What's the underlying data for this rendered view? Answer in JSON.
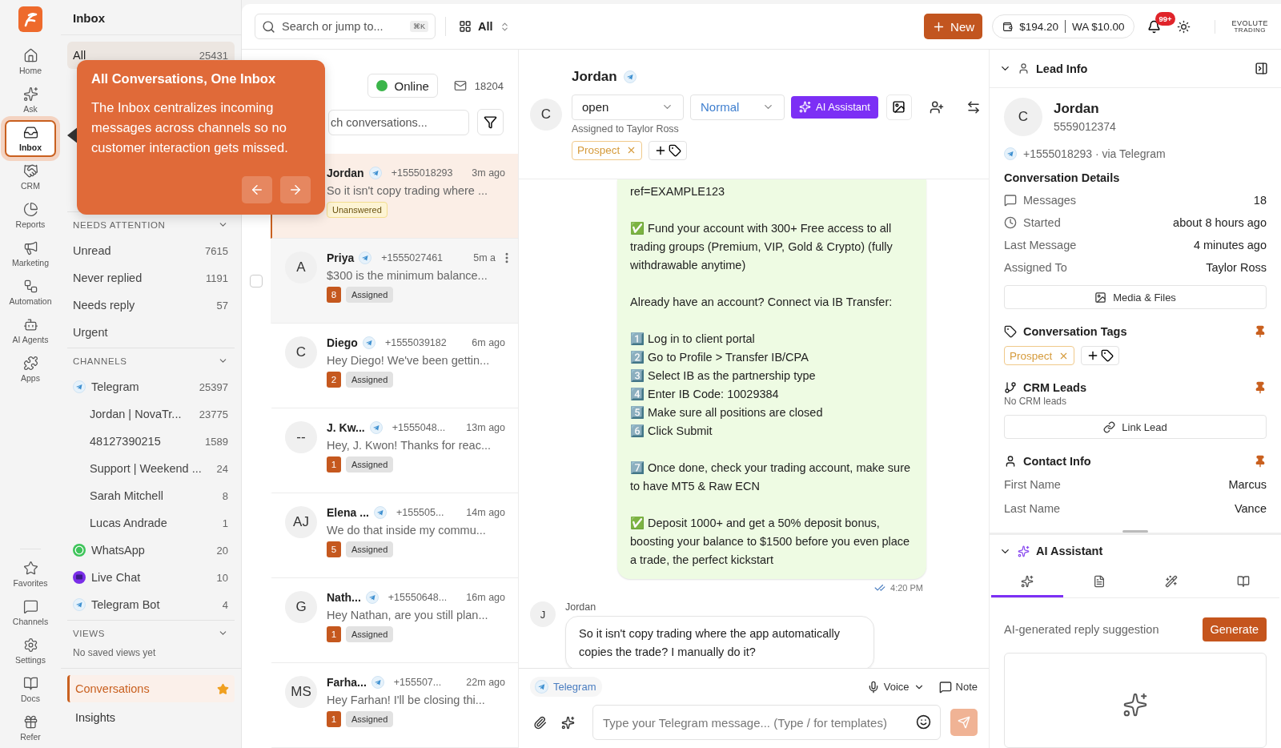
{
  "rail": {
    "top": [
      {
        "label": "Home",
        "selected": false
      },
      {
        "label": "Ask",
        "selected": false
      },
      {
        "label": "Inbox",
        "selected": true
      },
      {
        "label": "CRM",
        "selected": false
      },
      {
        "label": "Reports",
        "selected": false
      },
      {
        "label": "Marketing",
        "selected": false
      },
      {
        "label": "Automation",
        "selected": false
      },
      {
        "label": "AI Agents",
        "selected": false
      },
      {
        "label": "Apps",
        "selected": false
      }
    ],
    "bottom": [
      {
        "label": "Favorites",
        "selected": false
      },
      {
        "label": "Channels",
        "selected": false
      },
      {
        "label": "Settings",
        "selected": false
      },
      {
        "label": "Docs",
        "selected": false
      },
      {
        "label": "Refer",
        "selected": false
      }
    ]
  },
  "sidebar": {
    "title": "Inbox",
    "views": [
      {
        "label": "All",
        "count": "25431",
        "selected": true
      }
    ],
    "needs_attention": {
      "title": "NEEDS ATTENTION",
      "items": [
        {
          "label": "Unread",
          "count": "7615"
        },
        {
          "label": "Never replied",
          "count": "1191"
        },
        {
          "label": "Needs reply",
          "count": "57"
        },
        {
          "label": "Urgent"
        }
      ]
    },
    "channels": {
      "title": "CHANNELS",
      "items": [
        {
          "label": "Telegram",
          "count": "25397",
          "kind": "telegram",
          "children": [
            {
              "label": "Jordan | NovaTr...",
              "count": "23775"
            },
            {
              "label": "48127390215",
              "count": "1589"
            },
            {
              "label": "Support | Weekend ...",
              "count": "24"
            },
            {
              "label": "Sarah Mitchell",
              "count": "8"
            },
            {
              "label": "Lucas Andrade",
              "count": "1"
            }
          ]
        },
        {
          "label": "WhatsApp",
          "count": "20",
          "kind": "whatsapp"
        },
        {
          "label": "Live Chat",
          "count": "10",
          "kind": "livechat"
        },
        {
          "label": "Telegram Bot",
          "count": "4",
          "kind": "telegram"
        }
      ]
    },
    "saved_views": {
      "title": "VIEWS",
      "empty": "No saved views yet"
    },
    "pages": [
      {
        "label": "Conversations",
        "selected": true,
        "starred": true
      },
      {
        "label": "Insights",
        "selected": false,
        "starred": false
      }
    ]
  },
  "tooltip": {
    "title": "All Conversations, One Inbox",
    "body": "The Inbox centralizes incoming messages across channels so no customer interaction gets missed."
  },
  "topbar": {
    "search": {
      "placeholder": "Search or jump to...",
      "shortcut": "⌘K"
    },
    "scope": "All",
    "new_button": "New",
    "balance": "$194.20",
    "wa_balance": "WA $10.00",
    "notifications": "99+",
    "logo": [
      "EVOLUTE",
      "TRADING"
    ]
  },
  "conversation_list": {
    "status": "Online",
    "online": true,
    "mail_count": "18204",
    "search": {
      "placeholder": "ch conversations..."
    },
    "items": [
      {
        "name": "Jordan",
        "phone": "+1555018293",
        "time": "3m ago",
        "preview": "So it isn't copy trading where ...",
        "tag": {
          "label": "Unanswered",
          "kind": "unanswered"
        },
        "selected": true,
        "hovered": false
      },
      {
        "avatar": "A",
        "name": "Priya",
        "phone": "+1555027461",
        "time": "5m a",
        "preview": "$300 is the minimum balance...",
        "count": "8",
        "tag": {
          "label": "Assigned",
          "kind": "assigned"
        },
        "selected": false,
        "hovered": true,
        "checked": false
      },
      {
        "avatar": "C",
        "name": "Diego",
        "phone": "+1555039182",
        "time": "6m ago",
        "preview": "Hey Diego! We've been gettin...",
        "count": "2",
        "tag": {
          "label": "Assigned",
          "kind": "assigned"
        },
        "selected": false,
        "hovered": false
      },
      {
        "avatar": "--",
        "name": "J. Kw...",
        "phone": "+1555048...",
        "time": "13m ago",
        "preview": "Hey, J. Kwon! Thanks for reac...",
        "count": "1",
        "tag": {
          "label": "Assigned",
          "kind": "assigned"
        },
        "selected": false,
        "hovered": false
      },
      {
        "avatar": "AJ",
        "name": "Elena ...",
        "phone": "+155505...",
        "time": "14m ago",
        "preview": "We do that inside my commu...",
        "count": "5",
        "tag": {
          "label": "Assigned",
          "kind": "assigned"
        },
        "selected": false,
        "hovered": false
      },
      {
        "avatar": "G",
        "name": "Nath...",
        "phone": "+15550648...",
        "time": "16m ago",
        "preview": "Hey Nathan, are you still plan...",
        "count": "1",
        "tag": {
          "label": "Assigned",
          "kind": "assigned"
        },
        "selected": false,
        "hovered": false
      },
      {
        "avatar": "MS",
        "name": "Farha...",
        "phone": "+155507...",
        "time": "22m ago",
        "preview": "Hey Farhan! I'll be closing thi...",
        "count": "1",
        "tag": {
          "label": "Assigned",
          "kind": "assigned"
        },
        "selected": false,
        "hovered": false
      }
    ]
  },
  "chat": {
    "avatar": "C",
    "name": "Jordan",
    "status": "open",
    "priority": "Normal",
    "assigned": "Assigned to Taylor Ross",
    "tags": [
      "Prospect"
    ],
    "ai_button": "AI Assistant",
    "messages": [
      {
        "kind": "outgoing",
        "text": "ref=EXAMPLE123\n\n✅ Fund your account with 300+ Free access to all trading groups (Premium, VIP, Gold & Crypto) (fully withdrawable anytime)\n\nAlready have an account? Connect via IB Transfer:\n\n1️⃣ Log in to client portal\n2️⃣ Go to Profile > Transfer IB/CPA\n3️⃣ Select IB as the partnership type\n4️⃣ Enter IB Code: 10029384\n5️⃣ Make sure all positions are closed\n6️⃣ Click Submit\n\n7️⃣ Once done, check your trading account, make sure to have MT5 & Raw ECN\n\n✅ Deposit 1000+ and get a 50% deposit bonus, boosting your balance to $1500 before you even place a trade, the perfect kickstart",
        "time": "4:20 PM",
        "read": true
      },
      {
        "kind": "incoming",
        "avatar": "J",
        "sender": "Jordan",
        "text": "So it isn't copy trading where the app automatically copies the trade? I manually do it?"
      }
    ],
    "composer": {
      "channel": "Telegram",
      "voice": "Voice",
      "note": "Note",
      "placeholder": "Type your Telegram message... (Type / for templates)",
      "send_disabled": true
    }
  },
  "lead": {
    "title": "Lead Info",
    "avatar": "C",
    "name": "Jordan",
    "id": "5559012374",
    "contact": "+1555018293 · via Telegram",
    "details_title": "Conversation Details",
    "details": [
      {
        "label": "Messages",
        "value": "18"
      },
      {
        "label": "Started",
        "value": "about 8 hours ago"
      },
      {
        "label": "Last Message",
        "value": "4 minutes ago"
      },
      {
        "label": "Assigned To",
        "value": "Taylor Ross"
      }
    ],
    "media_button": "Media & Files",
    "tags_title": "Conversation Tags",
    "tags": [
      "Prospect"
    ],
    "crm_title": "CRM Leads",
    "crm_empty": "No CRM leads",
    "link_button": "Link Lead",
    "contact_title": "Contact Info",
    "contact_fields": [
      {
        "label": "First Name",
        "value": "Marcus"
      },
      {
        "label": "Last Name",
        "value": "Vance"
      }
    ]
  },
  "ai": {
    "title": "AI Assistant",
    "tabs": [
      {
        "kind": "suggest",
        "selected": true
      },
      {
        "kind": "summary",
        "selected": false
      },
      {
        "kind": "improve",
        "selected": false
      },
      {
        "kind": "knowledge",
        "selected": false
      }
    ],
    "caption": "AI-generated reply suggestion",
    "button": "Generate"
  }
}
